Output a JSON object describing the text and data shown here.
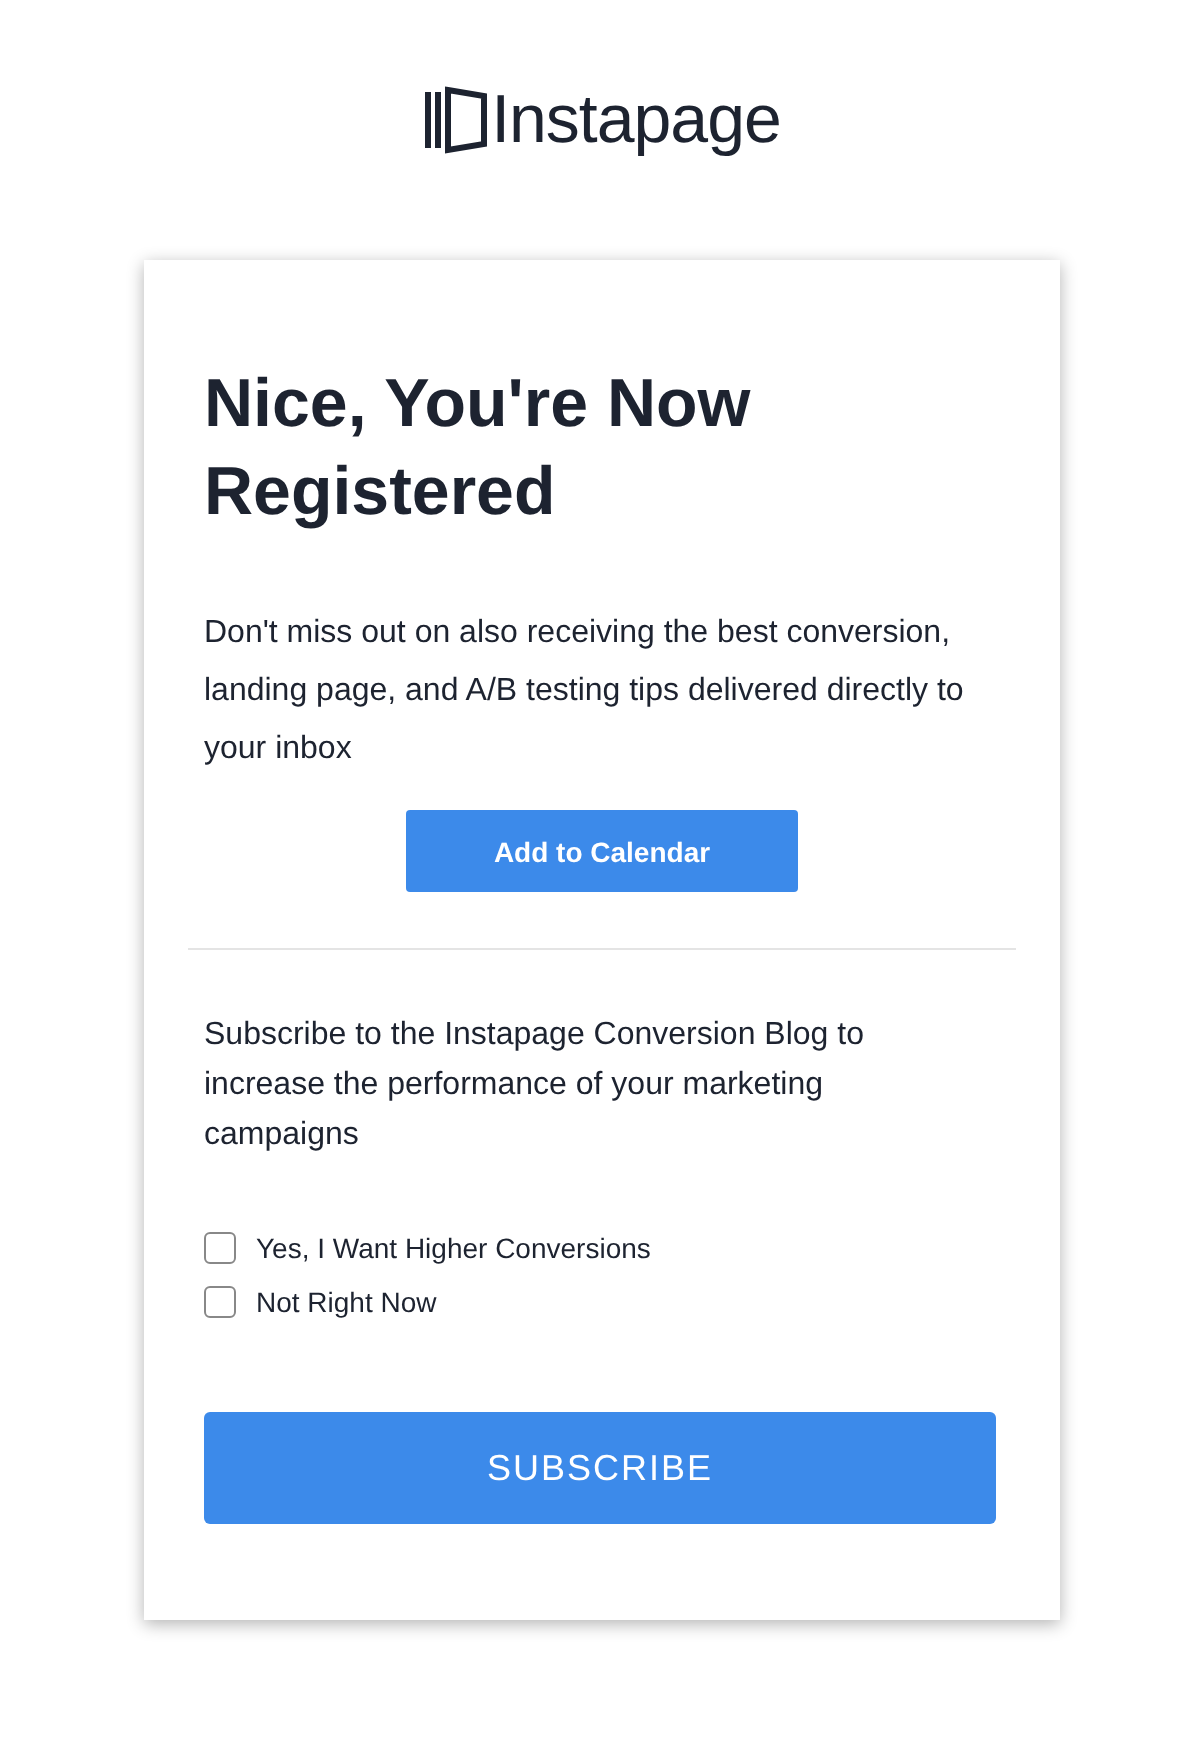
{
  "logo": {
    "text": "Instapage"
  },
  "card": {
    "title": "Nice, You're Now Registered",
    "intro": "Don't miss out on also receiving the best conversion, landing page, and A/B testing tips delivered directly to your inbox",
    "calendar_button": "Add to Calendar",
    "subscribe_text": "Subscribe to the Instapage Conversion Blog to increase the performance of your marketing campaigns",
    "options": [
      {
        "label": "Yes, I Want Higher Conversions",
        "checked": false
      },
      {
        "label": "Not Right Now",
        "checked": false
      }
    ],
    "subscribe_button": "SUBSCRIBE"
  }
}
